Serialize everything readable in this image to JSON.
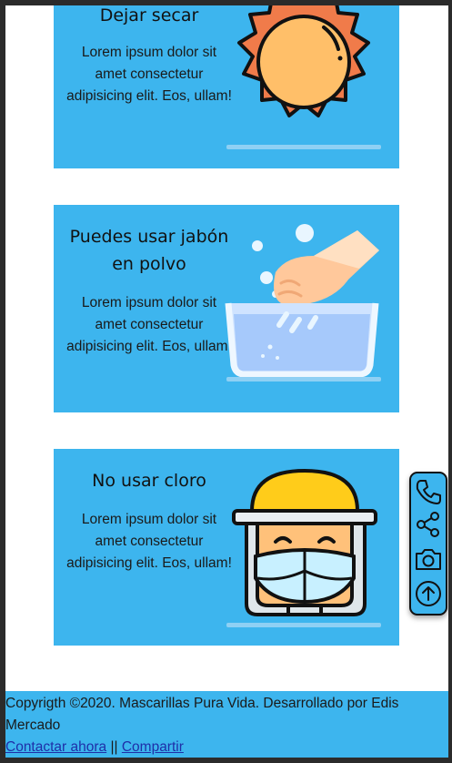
{
  "cards": [
    {
      "title": "Dejar secar",
      "body": "Lorem ipsum dolor sit amet consectetur adipisicing elit. Eos, ullam!",
      "illustration": "sun-icon"
    },
    {
      "title": "Puedes usar jabón en polvo",
      "body": "Lorem ipsum dolor sit amet consectetur adipisicing elit. Eos, ullam!",
      "illustration": "hand-washing-icon"
    },
    {
      "title": "No usar cloro",
      "body": "Lorem ipsum dolor sit amet consectetur adipisicing elit. Eos, ullam!",
      "illustration": "masked-face-shield-icon"
    }
  ],
  "footer": {
    "copyright": "Copyrigth ©2020. Mascarillas Pura Vida. Desarrollado por Edis Mercado",
    "contact_link": "Contactar ahora",
    "separator": "||",
    "share_link": "Compartir"
  },
  "floating_actions": [
    "phone-icon",
    "share-icon",
    "camera-icon",
    "scroll-up-icon"
  ],
  "colors": {
    "card_background": "#3db5ee",
    "page_background": "#ffffff",
    "frame": "#2b2b2b"
  }
}
